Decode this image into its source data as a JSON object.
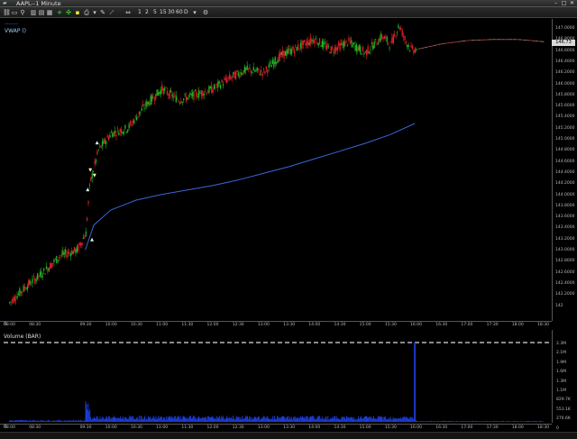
{
  "window": {
    "title": "AAPL--1 Minute",
    "close_symbol": "✕",
    "minimize_symbol": "–",
    "maximize_symbol": "□"
  },
  "toolbar": {
    "timeframes": [
      "1",
      "2",
      "5",
      "15",
      "30",
      "60",
      "D"
    ]
  },
  "price_panel": {
    "legend_primary": "-------",
    "legend_vwap": "VWAP ()",
    "last_price": "146.73",
    "axis_ticks": [
      "147.0000",
      "146.8000",
      "146.6000",
      "146.4000",
      "146.2000",
      "146.0000",
      "145.8000",
      "145.6000",
      "145.4000",
      "145.2000",
      "145.0000",
      "144.8000",
      "144.6000",
      "144.4000",
      "144.2000",
      "144.0000",
      "143.8000",
      "143.6000",
      "143.4000",
      "143.2000",
      "143.0000",
      "142.8000",
      "142.6000",
      "142.4000",
      "142.2000",
      "142"
    ],
    "vwap_color": "#3a66d6",
    "up_candle_color": "#1fb81f",
    "down_candle_color": "#e0202a"
  },
  "time_axis": {
    "corner": "0",
    "labels": [
      "08:00",
      "08:30",
      "09:30",
      "10:00",
      "10:30",
      "11:00",
      "11:30",
      "12:00",
      "12:30",
      "13:00",
      "13:30",
      "14:00",
      "14:30",
      "15:00",
      "15:30",
      "16:00",
      "16:30",
      "17:00",
      "17:30",
      "18:00",
      "18:30"
    ]
  },
  "volume_panel": {
    "label": "Volume (BAR)",
    "axis_ticks": [
      "2.3M",
      "2.1M",
      "1.9M",
      "1.6M",
      "1.3M",
      "1.1M",
      "829.7K",
      "553.1K",
      "276.6K",
      "0"
    ],
    "bar_color": "#1f3fe0",
    "max_volume_label": "2.3M"
  },
  "chart_data": [
    {
      "type": "candlestick",
      "title": "AAPL--1 Minute",
      "ylabel": "",
      "xlabel": "",
      "ylim": [
        142,
        147.15
      ],
      "series": [
        {
          "name": "VWAP ()",
          "type": "line",
          "x": [
            "09:30",
            "09:40",
            "10:00",
            "10:30",
            "11:00",
            "11:30",
            "12:00",
            "12:30",
            "13:00",
            "13:30",
            "14:00",
            "14:30",
            "15:00",
            "15:30",
            "15:59"
          ],
          "values": [
            143.0,
            143.45,
            143.72,
            143.9,
            144.0,
            144.08,
            144.16,
            144.26,
            144.38,
            144.5,
            144.64,
            144.78,
            144.92,
            145.08,
            145.28
          ]
        }
      ]
    },
    {
      "type": "bar",
      "title": "Volume (BAR)",
      "ylim": [
        0,
        2.3
      ],
      "series": [
        {
          "name": "Volume (BAR)",
          "unit": "M",
          "x": [
            "09:30",
            "16:00"
          ],
          "values": [
            0.55,
            2.3
          ]
        }
      ]
    }
  ]
}
